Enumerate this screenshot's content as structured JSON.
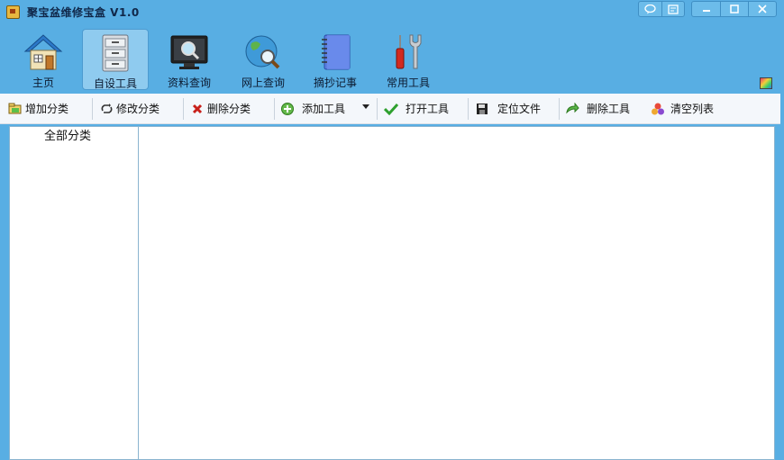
{
  "window": {
    "title": "聚宝盆维修宝盒 V1.0"
  },
  "system_buttons": [
    "speech-bubble-icon",
    "settings-panel-icon",
    "minimize-icon",
    "maximize-icon",
    "close-icon"
  ],
  "main_toolbar": [
    {
      "label": "主页",
      "icon": "home-icon"
    },
    {
      "label": "自设工具",
      "icon": "cabinet-icon",
      "active": true
    },
    {
      "label": "资料查询",
      "icon": "monitor-search-icon"
    },
    {
      "label": "网上查询",
      "icon": "globe-search-icon"
    },
    {
      "label": "摘抄记事",
      "icon": "notebook-icon"
    },
    {
      "label": "常用工具",
      "icon": "tools-icon"
    }
  ],
  "action_toolbar": [
    {
      "label": "增加分类",
      "icon": "add-category-icon"
    },
    {
      "label": "修改分类",
      "icon": "edit-category-icon"
    },
    {
      "label": "删除分类",
      "icon": "delete-category-icon"
    },
    {
      "label": "添加工具",
      "icon": "add-tool-icon"
    },
    {
      "label": "打开工具",
      "icon": "open-tool-icon"
    },
    {
      "label": "定位文件",
      "icon": "locate-file-icon"
    },
    {
      "label": "删除工具",
      "icon": "delete-tool-icon"
    },
    {
      "label": "清空列表",
      "icon": "clear-list-icon"
    }
  ],
  "category_tree": {
    "items": [
      "全部分类"
    ]
  },
  "colors": {
    "frame": "#58aee3",
    "active_tab": "#8fcbef",
    "toolbar_bg": "#f4f7fb",
    "panel_border": "#8ab4cf"
  }
}
